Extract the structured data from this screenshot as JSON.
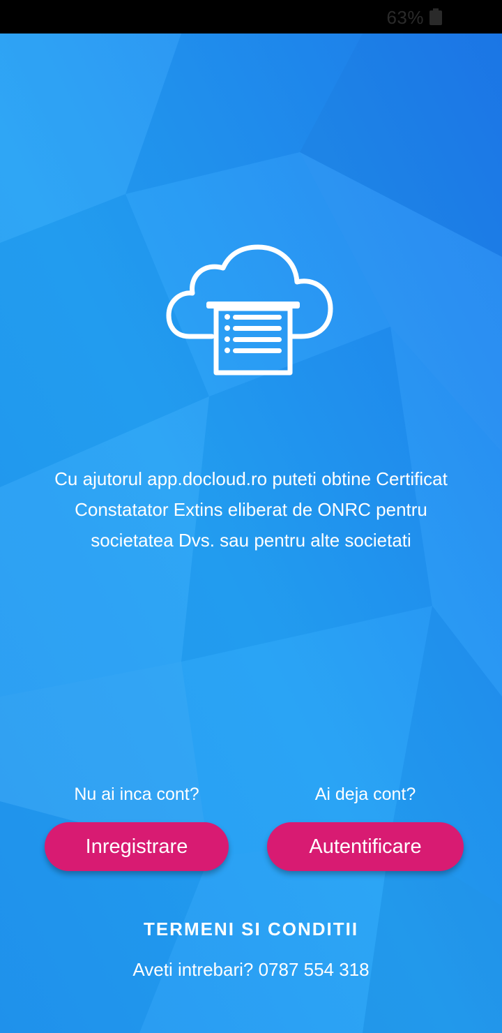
{
  "status_bar": {
    "battery_percent": "63%",
    "battery_icon": "battery-icon"
  },
  "logo": {
    "icon": "cloud-document-icon"
  },
  "description": "Cu ajutorul app.docloud.ro puteti obtine Certificat Constatator Extins eliberat de ONRC pentru societatea Dvs. sau pentru alte societati",
  "register": {
    "prompt": "Nu ai inca cont?",
    "label": "Inregistrare"
  },
  "login": {
    "prompt": "Ai deja cont?",
    "label": "Autentificare"
  },
  "terms_label": "TERMENI SI CONDITII",
  "contact_text": "Aveti intrebari? 0787 554 318",
  "colors": {
    "background": "#2196f3",
    "button": "#d81b72",
    "text": "#ffffff"
  }
}
